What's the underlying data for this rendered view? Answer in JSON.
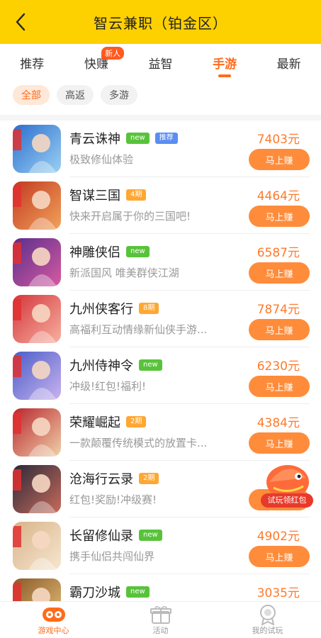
{
  "header": {
    "title": "智云兼职（铂金区）",
    "back_icon": "back-arrow-icon"
  },
  "tabs": [
    {
      "label": "推荐",
      "active": false,
      "badge": ""
    },
    {
      "label": "快赚",
      "active": false,
      "badge": "新人"
    },
    {
      "label": "益智",
      "active": false,
      "badge": ""
    },
    {
      "label": "手游",
      "active": true,
      "badge": ""
    },
    {
      "label": "最新",
      "active": false,
      "badge": ""
    }
  ],
  "filters": [
    {
      "label": "全部",
      "active": true
    },
    {
      "label": "高返",
      "active": false
    },
    {
      "label": "多游",
      "active": false
    }
  ],
  "games": [
    {
      "name": "青云诛神",
      "tags": [
        {
          "text": "new",
          "color": "green"
        },
        {
          "text": "推荐",
          "color": "blue"
        }
      ],
      "desc": "极致修仙体验",
      "price": "7403元",
      "button": "马上赚",
      "icon_colors": [
        "#2b6fcf",
        "#9bd0f2"
      ]
    },
    {
      "name": "智谋三国",
      "tags": [
        {
          "text": "4期",
          "color": "orange"
        }
      ],
      "desc": "快来开启属于你的三国吧!",
      "price": "4464元",
      "button": "马上赚",
      "icon_colors": [
        "#c23a22",
        "#f2a25a"
      ]
    },
    {
      "name": "神雕侠侣",
      "tags": [
        {
          "text": "new",
          "color": "green"
        }
      ],
      "desc": "新派国风 唯美群侠江湖",
      "price": "6587元",
      "button": "马上赚",
      "icon_colors": [
        "#5a2f8c",
        "#d65aa0"
      ]
    },
    {
      "name": "九州侠客行",
      "tags": [
        {
          "text": "8期",
          "color": "orange"
        }
      ],
      "desc": "高福利互动情缘新仙侠手游...",
      "price": "7874元",
      "button": "马上赚",
      "icon_colors": [
        "#d4363c",
        "#f7b0a0"
      ]
    },
    {
      "name": "九州侍神令",
      "tags": [
        {
          "text": "new",
          "color": "green"
        }
      ],
      "desc": "冲级!红包!福利!",
      "price": "6230元",
      "button": "马上赚",
      "icon_colors": [
        "#4a5ec8",
        "#c9b2ef"
      ]
    },
    {
      "name": "荣耀崛起",
      "tags": [
        {
          "text": "2期",
          "color": "orange"
        }
      ],
      "desc": "一款颠覆传统模式的放置卡...",
      "price": "4384元",
      "button": "马上赚",
      "icon_colors": [
        "#b8262e",
        "#f0d0a8"
      ]
    },
    {
      "name": "沧海行云录",
      "tags": [
        {
          "text": "2期",
          "color": "orange"
        }
      ],
      "desc": "红包!奖励!冲级赛!",
      "price": "6",
      "button": "马",
      "icon_colors": [
        "#2a2a3a",
        "#c86a5a"
      ]
    },
    {
      "name": "长留修仙录",
      "tags": [
        {
          "text": "new",
          "color": "green"
        }
      ],
      "desc": "携手仙侣共闯仙界",
      "price": "4902元",
      "button": "马上赚",
      "icon_colors": [
        "#d8b48a",
        "#f6e6cf"
      ]
    },
    {
      "name": "霸刀沙城",
      "tags": [
        {
          "text": "new",
          "color": "green"
        }
      ],
      "desc": "",
      "price": "3035元",
      "button": "",
      "icon_colors": [
        "#8a5a2a",
        "#e8c27a"
      ]
    }
  ],
  "float_banner": {
    "label": "试玩领红包"
  },
  "bottom_nav": [
    {
      "label": "游戏中心",
      "active": true,
      "icon": "gamepad-icon"
    },
    {
      "label": "活动",
      "active": false,
      "icon": "gift-box-icon"
    },
    {
      "label": "我的试玩",
      "active": false,
      "icon": "medal-icon"
    }
  ],
  "colors": {
    "header_bg": "#fdd000",
    "accent": "#ff6b1a",
    "button_bg": "#ff8c3a",
    "price": "#ff7a2b"
  }
}
